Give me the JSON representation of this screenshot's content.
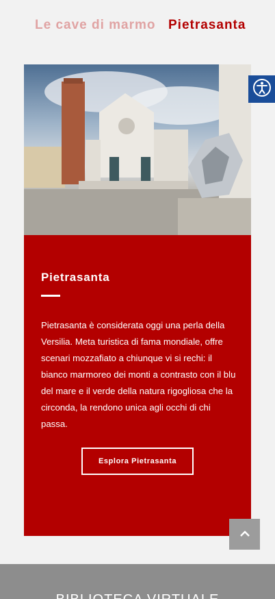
{
  "tabs": [
    {
      "label": "Le cave di marmo"
    },
    {
      "label": "Pietrasanta"
    }
  ],
  "card": {
    "title": "Pietrasanta",
    "description": "Pietrasanta è considerata oggi una perla della Versilia. Meta turistica di fama mondiale, offre scenari mozzafiato a chiunque vi si rechi: il bianco marmoreo dei monti a contrasto con il blu del mare e il verde della natura rigogliosa che la circonda, la rendono unica agli occhi di chi passa.",
    "button_label": "Esplora Pietrasanta",
    "image_icon": "cathedral-photo"
  },
  "accessibility": {
    "icon": "accessibility-icon"
  },
  "back_to_top": {
    "icon": "chevron-up-icon"
  },
  "footer": {
    "title": "BIBLIOTECA VIRTUALE"
  },
  "colors": {
    "brand_red": "#b30000",
    "tab_inactive": "#e0a3a3",
    "accessibility_blue": "#1a4d99"
  }
}
